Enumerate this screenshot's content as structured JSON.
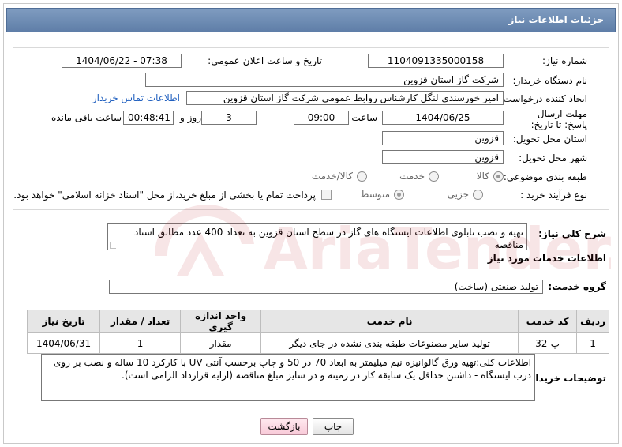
{
  "header": {
    "title": "جزئیات اطلاعات نیاز"
  },
  "form": {
    "need_number_label": "شماره نیاز:",
    "need_number": "1104091335000158",
    "announce_label": "تاریخ و ساعت اعلان عمومی:",
    "announce_value": "1404/06/22 - 07:38",
    "buyer_org_label": "نام دستگاه خریدار:",
    "buyer_org": "شرکت گاز استان قزوین",
    "requester_label": "ایجاد کننده درخواست:",
    "requester": "امیر خورسندی لنگل کارشناس روابط عمومی شرکت گاز استان قزوین",
    "contact_link": "اطلاعات تماس خریدار",
    "deadline_label": "مهلت ارسال پاسخ: تا تاریخ:",
    "deadline_date": "1404/06/25",
    "time_label": "ساعت",
    "deadline_time": "09:00",
    "days_value": "3",
    "days_label": "روز و",
    "remaining_time": "00:48:41",
    "remaining_label": "ساعت باقی مانده",
    "delivery_province_label": "استان محل تحویل:",
    "delivery_province": "قزوین",
    "delivery_city_label": "شهر محل تحویل:",
    "delivery_city": "قزوین",
    "category_label": "طبقه بندی موضوعی:",
    "category_options": [
      "کالا",
      "خدمت",
      "کالا/خدمت"
    ],
    "process_label": "نوع فرآیند خرید :",
    "process_options": [
      "جزیی",
      "متوسط"
    ],
    "payment_note": "پرداخت تمام یا بخشی از مبلغ خرید،از محل \"اسناد خزانه اسلامی\" خواهد بود."
  },
  "summary": {
    "label": "شرح کلی نیاز:",
    "text": "تهیه و نصب تابلوی اطلاعات ایستگاه های گاز در سطح استان قزوین به تعداد 400 عدد مطابق اسناد مناقصه"
  },
  "services": {
    "section_title": "اطلاعات خدمات مورد نیاز",
    "group_label": "گروه خدمت:",
    "group_value": "تولید صنعتی (ساخت)",
    "columns": [
      "ردیف",
      "کد خدمت",
      "نام خدمت",
      "واحد اندازه گیری",
      "تعداد / مقدار",
      "تاریخ نیاز"
    ],
    "rows": [
      [
        "1",
        "پ-32",
        "تولید سایر مصنوعات طبقه بندی نشده در جای دیگر",
        "مقدار",
        "1",
        "1404/06/31"
      ]
    ]
  },
  "buyer_notes": {
    "label": "توضیحات خریدار:",
    "text": "اطلاعات کلی:تهیه ورق گالوانیزه نیم میلیمتر به ابعاد 70 در 50 و چاپ برچسب آنتی UV با کارکرد 10 ساله و نصب بر روی درب ایستگاه  - داشتن حداقل یک سابقه کار در زمینه و در سایز مبلغ مناقصه (ارایه قرارداد الزامی است)."
  },
  "buttons": {
    "print": "چاپ",
    "back": "بازگشت"
  },
  "watermark": {
    "text": "AriaTender.neT"
  },
  "colors": {
    "title_bar": "#6f8cb4",
    "link": "#1f5fbf",
    "back_button": "#f8cad8"
  }
}
